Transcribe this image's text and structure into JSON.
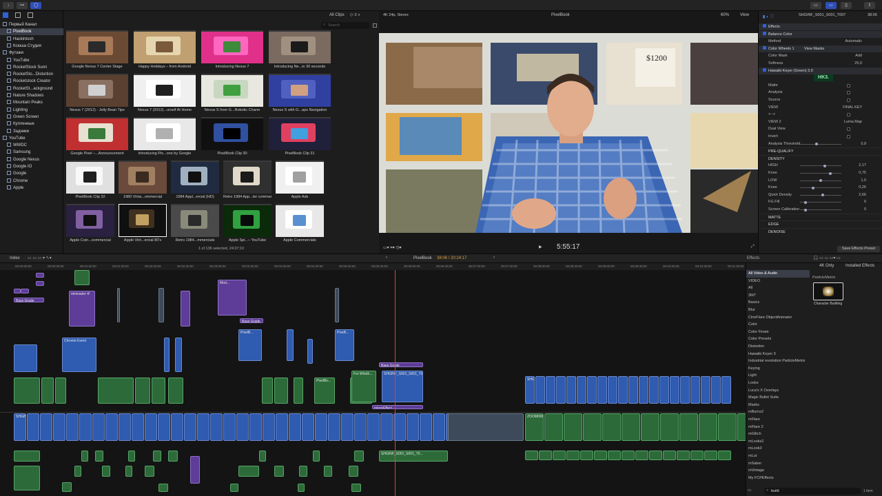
{
  "toolbar": {
    "import_icon": "↓",
    "keywords_icon": "🗝",
    "bg_icon": "◯"
  },
  "libraries": [
    {
      "label": "Первый Канал",
      "level": 0,
      "kind": "library"
    },
    {
      "label": "PixelBook",
      "level": 1,
      "kind": "event",
      "selected": true
    },
    {
      "label": "Hackintosh",
      "level": 1,
      "kind": "event"
    },
    {
      "label": "Ксюша Студия",
      "level": 1,
      "kind": "event"
    },
    {
      "label": "Футажи",
      "level": 0,
      "kind": "library"
    },
    {
      "label": "YouTube",
      "level": 1,
      "kind": "event"
    },
    {
      "label": "RocketStock Sumi",
      "level": 1,
      "kind": "event"
    },
    {
      "label": "RocketSto...Distortion",
      "level": 1,
      "kind": "event"
    },
    {
      "label": "Rocketstock Creator",
      "level": 1,
      "kind": "event"
    },
    {
      "label": "RocketSt...ackground",
      "level": 1,
      "kind": "event"
    },
    {
      "label": "Nature Shadows",
      "level": 1,
      "kind": "event"
    },
    {
      "label": "Mountain Peaks",
      "level": 1,
      "kind": "event"
    },
    {
      "label": "Lighting",
      "level": 1,
      "kind": "event"
    },
    {
      "label": "Green Screen",
      "level": 1,
      "kind": "event"
    },
    {
      "label": "Купленные",
      "level": 1,
      "kind": "event"
    },
    {
      "label": "Задники",
      "level": 1,
      "kind": "event"
    },
    {
      "label": "YouTube",
      "level": 0,
      "kind": "library"
    },
    {
      "label": "WWDC",
      "level": 1,
      "kind": "event"
    },
    {
      "label": "Samsung",
      "level": 1,
      "kind": "event"
    },
    {
      "label": "Google Nexus",
      "level": 1,
      "kind": "event"
    },
    {
      "label": "Google IO",
      "level": 1,
      "kind": "event"
    },
    {
      "label": "Google",
      "level": 1,
      "kind": "event"
    },
    {
      "label": "Chrome",
      "level": 1,
      "kind": "event"
    },
    {
      "label": "Apple",
      "level": 1,
      "kind": "event"
    }
  ],
  "browser": {
    "filter": "All Clips",
    "search_placeholder": "Search",
    "status": "1 of 136 selected, 24:37:10"
  },
  "clips": [
    {
      "caption": "Google Nexus 7 Center Stage",
      "colors": [
        "#6b4a34",
        "#a87a58",
        "#2a2a2a"
      ]
    },
    {
      "caption": "Happy Holidays – from Android",
      "colors": [
        "#c0a070",
        "#e6d6b0",
        "#7a5a3a"
      ]
    },
    {
      "caption": "Introducing Nexus 7",
      "colors": [
        "#e0308a",
        "#ff66c0",
        "#3d8a3a"
      ]
    },
    {
      "caption": "Introducing Ne...in 30 seconds",
      "colors": [
        "#7a6a60",
        "#a09080",
        "#1a1a1a"
      ]
    },
    {
      "caption": "Nexus 7 (2012) - Jelly Bean Tips",
      "colors": [
        "#5a4030",
        "#8a7060",
        "#d0d0d0"
      ]
    },
    {
      "caption": "Nexus 7 (2012)...urself At Home",
      "colors": [
        "#f0f0f0",
        "#ffffff",
        "#202020"
      ]
    },
    {
      "caption": "Nexus S from G...Robotic Charm",
      "colors": [
        "#e8e8e0",
        "#c8d8c0",
        "#40a040"
      ]
    },
    {
      "caption": "Nexus S with G...aps Navigation",
      "colors": [
        "#3040a0",
        "#5060c0",
        "#d0a080"
      ]
    },
    {
      "caption": "Google Pixel –...Announcement",
      "colors": [
        "#c03030",
        "#e8e0d0",
        "#3a7a3a"
      ]
    },
    {
      "caption": "Introducing Pix...one by Google",
      "colors": [
        "#e8e8e8",
        "#ffffff",
        "#b0b0b0"
      ]
    },
    {
      "caption": "PixelBook Clip 30",
      "colors": [
        "#101010",
        "#3050a0",
        "#000000"
      ]
    },
    {
      "caption": "PixelBook Clip 31",
      "colors": [
        "#20203a",
        "#e04060",
        "#40a0e0"
      ]
    },
    {
      "caption": "PixelBook Clip 32",
      "colors": [
        "#e0e0e0",
        "#f8f8f8",
        "#202020"
      ]
    },
    {
      "caption": "1980 Vinta...ommercial",
      "colors": [
        "#6a4a3a",
        "#a08060",
        "#3a2a20"
      ]
    },
    {
      "caption": "1984 Appl...ercial (HD)",
      "colors": [
        "#202a40",
        "#a0b0c0",
        "#101010"
      ]
    },
    {
      "caption": "Retro 1984 App...ter commercial",
      "colors": [
        "#303030",
        "#e0d8c8",
        "#1a1a1a"
      ]
    },
    {
      "caption": "Apple Ads",
      "colors": [
        "#f0f0f0",
        "#ffffff",
        "#a0a0a0"
      ]
    },
    {
      "caption": "Apple Coin...commercial",
      "colors": [
        "#2a2040",
        "#8060a0",
        "#101010"
      ]
    },
    {
      "caption": "Apple Vint...ercial 80's",
      "colors": [
        "#101010",
        "#403020",
        "#c0a060"
      ]
    },
    {
      "caption": "Retro 1984...mmercials",
      "colors": [
        "#4a4a4a",
        "#8a8a7a",
        "#2a2a2a"
      ]
    },
    {
      "caption": "Apple Spi...– YouTube",
      "colors": [
        "#0a2a0a",
        "#30a040",
        "#0a0a0a"
      ]
    },
    {
      "caption": "Apple Commercials",
      "colors": [
        "#e8e8e8",
        "#ffffff",
        "#5a90d0"
      ]
    }
  ],
  "viewer": {
    "format": "4K 24p, Stereo",
    "title": "PixelBook",
    "zoom": "60%",
    "view_label": "View",
    "timecode": "5:55:17"
  },
  "inspector": {
    "clip_name": "SHGINF_S001_S001_T007",
    "duration": "38:06",
    "rows": [
      {
        "label": "Effects",
        "value": "",
        "checked": true,
        "kind": "section"
      },
      {
        "label": "Balance Color",
        "value": "",
        "checked": true,
        "kind": "effect"
      },
      {
        "label": "Method",
        "value": "Automatic",
        "checked": null,
        "kind": "param"
      },
      {
        "label": "Color Wheels 1",
        "value": "View Masks",
        "checked": true,
        "kind": "effect"
      },
      {
        "label": "Color Mask",
        "value": "Add",
        "checked": true,
        "kind": "param"
      },
      {
        "label": "Softness",
        "value": "25,0",
        "checked": null,
        "kind": "param"
      },
      {
        "label": "Hawaiki Keyer (Green) 3.0",
        "value": "",
        "checked": true,
        "kind": "effect"
      },
      {
        "label": "",
        "value": "",
        "checked": null,
        "kind": "logo"
      },
      {
        "label": "Matte",
        "value": "",
        "checked": false,
        "kind": "param"
      },
      {
        "label": "Analysis",
        "value": "",
        "checked": false,
        "kind": "param"
      },
      {
        "label": "Source",
        "value": "",
        "checked": false,
        "kind": "param"
      },
      {
        "label": "VIEW",
        "value": "FINAL KEY",
        "checked": null,
        "kind": "param"
      },
      {
        "label": "<-->",
        "value": "",
        "checked": false,
        "kind": "param"
      },
      {
        "label": "VIEW 2",
        "value": "Luma Map",
        "checked": null,
        "kind": "param"
      },
      {
        "label": "Dual View",
        "value": "",
        "checked": false,
        "kind": "param"
      },
      {
        "label": "Invert",
        "value": "",
        "checked": false,
        "kind": "param"
      },
      {
        "label": "Analysis Threshold",
        "value": "0,9",
        "checked": null,
        "kind": "slider"
      },
      {
        "label": "PRE-QUALIFY",
        "value": "",
        "checked": null,
        "kind": "group"
      },
      {
        "label": "DENSITY",
        "value": "",
        "checked": null,
        "kind": "group"
      },
      {
        "label": "HIGH",
        "value": "2,17",
        "checked": null,
        "kind": "slider"
      },
      {
        "label": "Knee",
        "value": "0,75",
        "checked": null,
        "kind": "slider"
      },
      {
        "label": "LOW",
        "value": "1,0",
        "checked": null,
        "kind": "slider"
      },
      {
        "label": "Knee",
        "value": "0,26",
        "checked": null,
        "kind": "slider"
      },
      {
        "label": "Quick Density",
        "value": "2,66",
        "checked": null,
        "kind": "slider"
      },
      {
        "label": "FG Fill",
        "value": "0",
        "checked": null,
        "kind": "slider"
      },
      {
        "label": "Screen Calibration",
        "value": "0",
        "checked": null,
        "kind": "slider"
      },
      {
        "label": "MATTE",
        "value": "",
        "checked": null,
        "kind": "group"
      },
      {
        "label": "EDGE",
        "value": "",
        "checked": null,
        "kind": "group"
      },
      {
        "label": "DENOISE",
        "value": "",
        "checked": null,
        "kind": "group"
      }
    ],
    "logo_text": "HK3.",
    "save_preset": "Save Effects Preset"
  },
  "timeline": {
    "index_label": "Index",
    "project": "PixelBook",
    "timecode": "38:06 / 20:24:17",
    "ruler": [
      "00:00:00:00",
      "00:00:30:00",
      "00:01:00:00",
      "00:01:30:00",
      "00:02:00:00",
      "00:02:30:00",
      "00:03:00:00",
      "00:03:30:00",
      "00:04:00:00",
      "00:04:30:00",
      "00:05:00:00",
      "00:05:30:00",
      "00:06:00:00",
      "00:06:30:00",
      "00:07:00:00",
      "00:07:30:00",
      "00:08:00:00",
      "00:08:30:00",
      "00:09:00:00",
      "00:09:30:00",
      "00:10:00:00",
      "00:10:30:00",
      "00:11:00:00"
    ],
    "labels": [
      "Bass Grade",
      "minivader 4!",
      "Chrome Event",
      "PixelB...",
      "Mod...",
      "Base Grade",
      "PixeB...",
      "Base Grade",
      "For Wheth...",
      "SHGINF_S001_S001_T0...",
      "PixelBo...",
      "mirrorEffect",
      "SHGINF_S001_S001_T0...",
      "SHGINF_S...",
      "ZOOM0001...",
      "ZOOM000...",
      "SHGINF_S001_S001_T0..."
    ]
  },
  "effects_browser": {
    "title": "Effects",
    "filter": "4K Only",
    "installed": "Installed Effects",
    "categories": [
      "All Video & Audio",
      "VIDEO",
      "All",
      "360°",
      "Basics",
      "Blur",
      "CineFlare ObjectAnimator",
      "Color",
      "Color Finale",
      "Color Presets",
      "Distortion",
      "Hawaiki Keyer 3",
      "Industrial revolution ParticleMetrix",
      "Keying",
      "Light",
      "Looks",
      "Luca's X Overlays",
      "Magic Bullet Suite",
      "Masks",
      "mBurns2",
      "mFlare",
      "mFlare 2",
      "mGlitch",
      "mLooks2",
      "mLook3",
      "mLut",
      "mSaber",
      "mVintage",
      "My FCPEffects"
    ],
    "group": "ParticleMetrix",
    "tile": "Character Building",
    "search": "build",
    "count": "1 item"
  }
}
